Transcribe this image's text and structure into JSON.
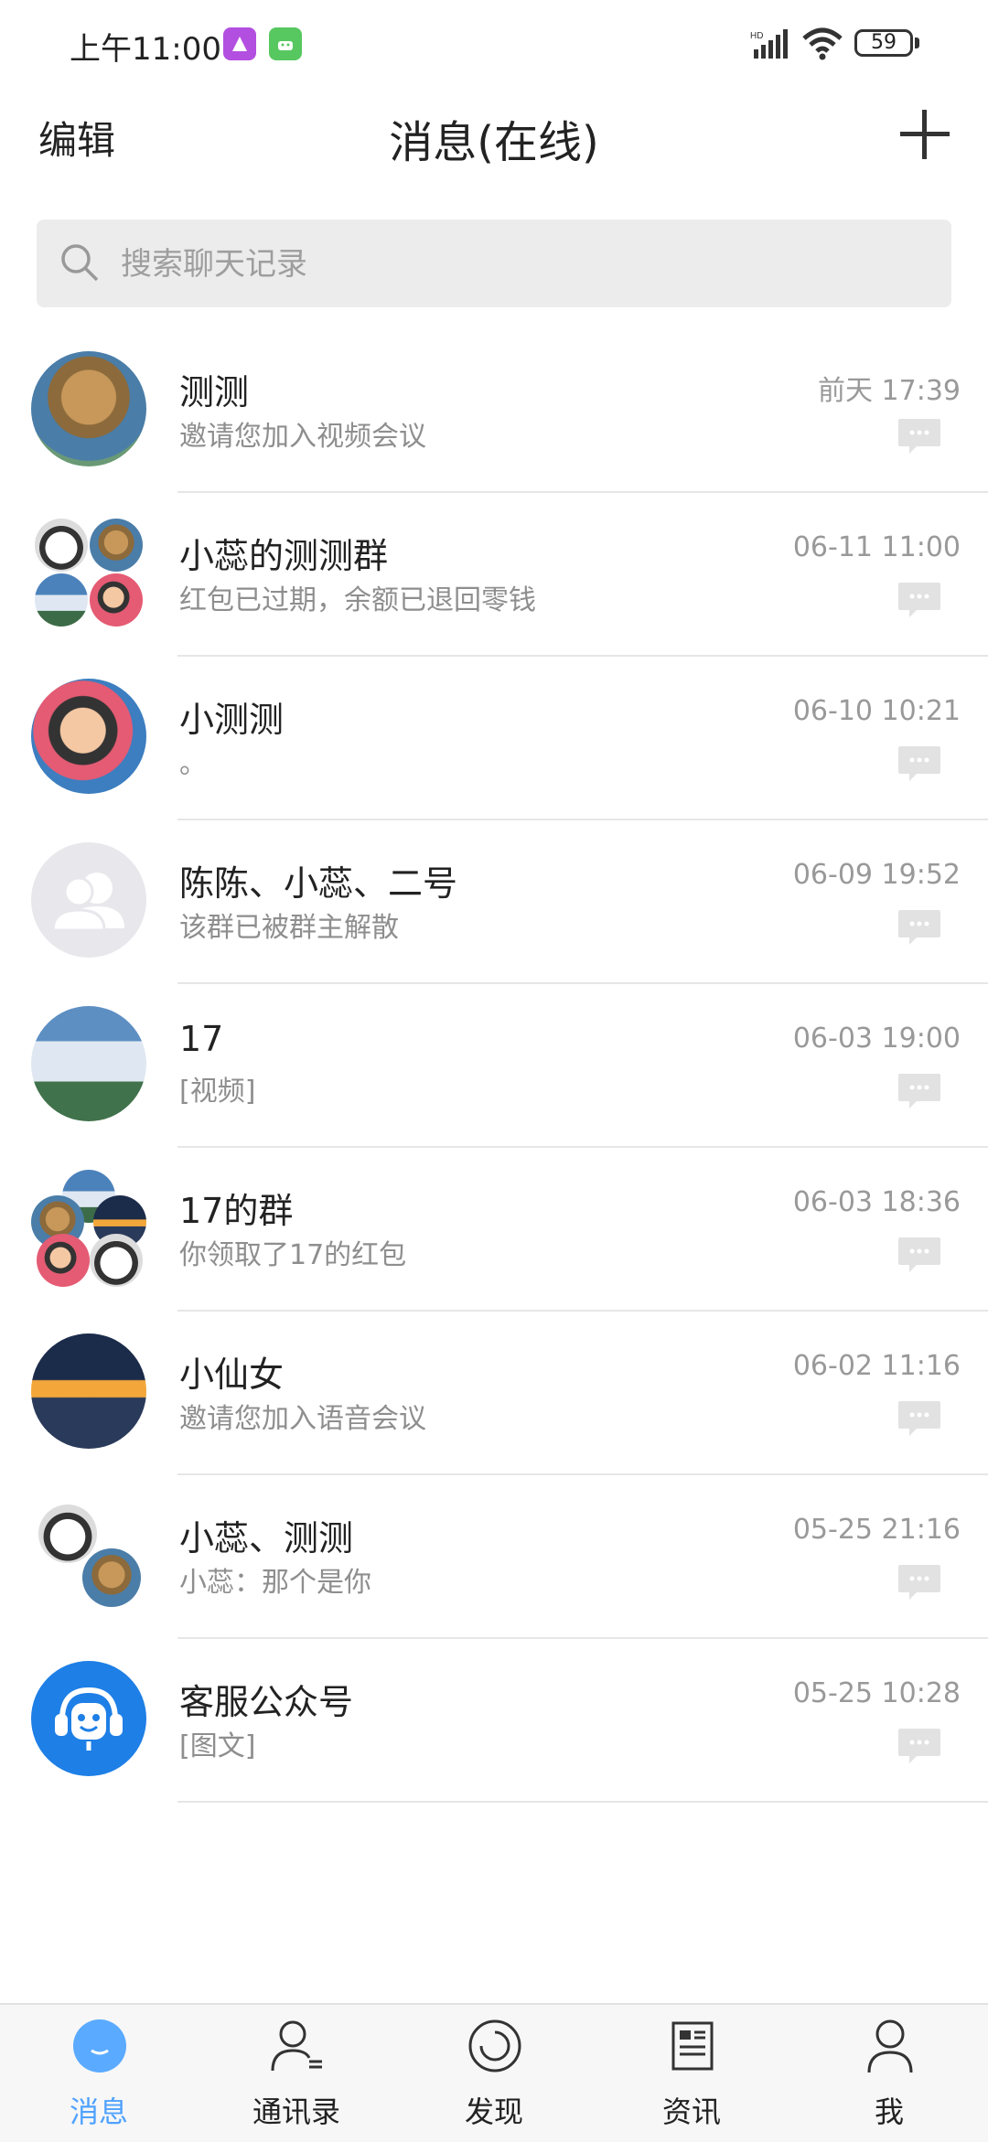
{
  "status_bar": {
    "time": "上午11:00",
    "battery": "59",
    "signal_label": "HD"
  },
  "header": {
    "edit_label": "编辑",
    "title": "消息(在线)",
    "add_icon": "plus-icon"
  },
  "search": {
    "placeholder": "搜索聊天记录",
    "icon": "search-icon"
  },
  "conversations": [
    {
      "name": "测测",
      "last_message": "邀请您加入视频会议",
      "time": "前天 17:39"
    },
    {
      "name": "小蕊的测测群",
      "last_message": "红包已过期，余额已退回零钱",
      "time": "06-11 11:00"
    },
    {
      "name": "小测测",
      "last_message": "。",
      "time": "06-10 10:21"
    },
    {
      "name": "陈陈、小蕊、二号",
      "last_message": "该群已被群主解散",
      "time": "06-09 19:52"
    },
    {
      "name": "17",
      "last_message": "[视频]",
      "time": "06-03 19:00"
    },
    {
      "name": "17的群",
      "last_message": "你领取了17的红包",
      "time": "06-03 18:36"
    },
    {
      "name": "小仙女",
      "last_message": "邀请您加入语音会议",
      "time": "06-02 11:16"
    },
    {
      "name": "小蕊、测测",
      "last_message": "小蕊：那个是你",
      "time": "05-25 21:16"
    },
    {
      "name": "客服公众号",
      "last_message": "[图文]",
      "time": "05-25 10:28"
    }
  ],
  "tabs": [
    {
      "label": "消息",
      "icon": "chat-bubble-icon",
      "active": true
    },
    {
      "label": "通讯录",
      "icon": "contacts-icon",
      "active": false
    },
    {
      "label": "发现",
      "icon": "discover-icon",
      "active": false
    },
    {
      "label": "资讯",
      "icon": "news-icon",
      "active": false
    },
    {
      "label": "我",
      "icon": "profile-icon",
      "active": false
    }
  ],
  "colors": {
    "accent": "#4fa2ff",
    "background": "#ffffff",
    "secondary_text": "#8e8e8e",
    "service_avatar": "#1e7fe6"
  }
}
